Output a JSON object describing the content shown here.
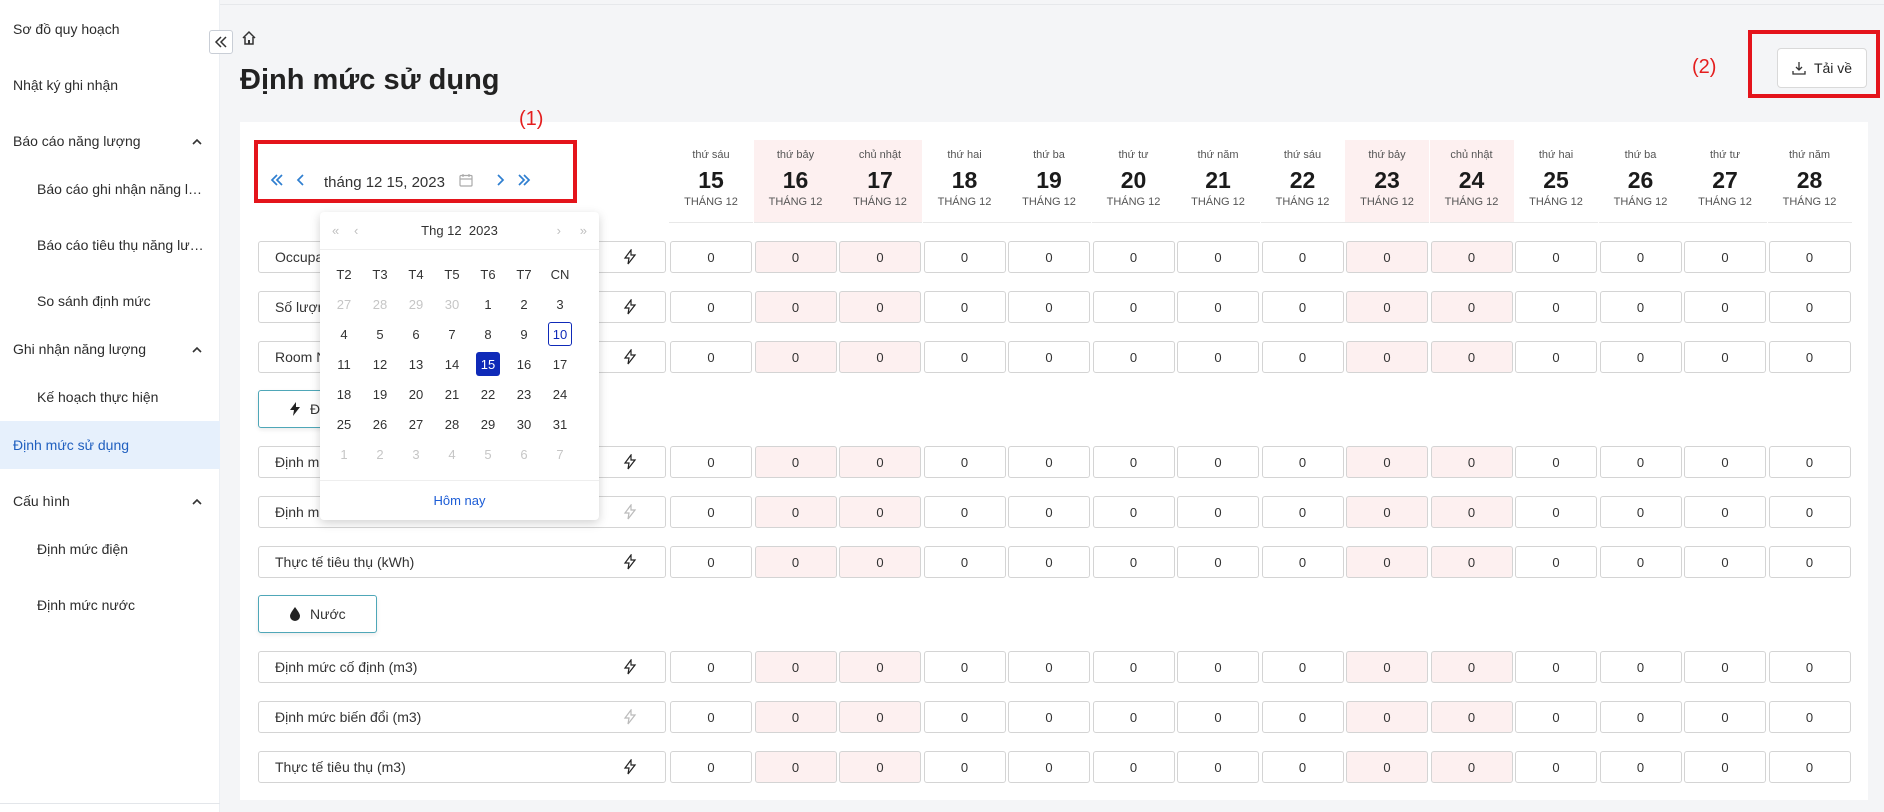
{
  "sidebar": {
    "items": [
      {
        "label": "Sơ đồ quy hoạch"
      },
      {
        "label": "Nhật ký ghi nhận"
      },
      {
        "label": "Báo cáo năng lượng"
      },
      {
        "label": "Báo cáo ghi nhận năng lượng"
      },
      {
        "label": "Báo cáo tiêu thụ năng lượng"
      },
      {
        "label": "So sánh định mức"
      },
      {
        "label": "Ghi nhận năng lượng"
      },
      {
        "label": "Kế hoạch thực hiện"
      },
      {
        "label": "Định mức sử dụng"
      },
      {
        "label": "Cấu hình"
      },
      {
        "label": "Định mức điện"
      },
      {
        "label": "Định mức nước"
      }
    ]
  },
  "header": {
    "title": "Định mức sử dụng",
    "download_label": "Tải về",
    "annotation_1": "(1)",
    "annotation_2": "(2)"
  },
  "date_picker": {
    "value": "tháng 12 15, 2023"
  },
  "days": [
    {
      "name": "thứ sáu",
      "num": "15",
      "month": "THÁNG 12"
    },
    {
      "name": "thứ bảy",
      "num": "16",
      "month": "THÁNG 12"
    },
    {
      "name": "chủ nhật",
      "num": "17",
      "month": "THÁNG 12"
    },
    {
      "name": "thứ hai",
      "num": "18",
      "month": "THÁNG 12"
    },
    {
      "name": "thứ ba",
      "num": "19",
      "month": "THÁNG 12"
    },
    {
      "name": "thứ tư",
      "num": "20",
      "month": "THÁNG 12"
    },
    {
      "name": "thứ năm",
      "num": "21",
      "month": "THÁNG 12"
    },
    {
      "name": "thứ sáu",
      "num": "22",
      "month": "THÁNG 12"
    },
    {
      "name": "thứ bảy",
      "num": "23",
      "month": "THÁNG 12"
    },
    {
      "name": "chủ nhật",
      "num": "24",
      "month": "THÁNG 12"
    },
    {
      "name": "thứ hai",
      "num": "25",
      "month": "THÁNG 12"
    },
    {
      "name": "thứ ba",
      "num": "26",
      "month": "THÁNG 12"
    },
    {
      "name": "thứ tư",
      "num": "27",
      "month": "THÁNG 12"
    },
    {
      "name": "thứ năm",
      "num": "28",
      "month": "THÁNG 12"
    }
  ],
  "rows": [
    {
      "label": "Occupa",
      "values": [
        "0",
        "0",
        "0",
        "0",
        "0",
        "0",
        "0",
        "0",
        "0",
        "0",
        "0",
        "0",
        "0",
        "0"
      ]
    },
    {
      "label": "Số lượn",
      "values": [
        "0",
        "0",
        "0",
        "0",
        "0",
        "0",
        "0",
        "0",
        "0",
        "0",
        "0",
        "0",
        "0",
        "0"
      ]
    },
    {
      "label": "Room N",
      "values": [
        "0",
        "0",
        "0",
        "0",
        "0",
        "0",
        "0",
        "0",
        "0",
        "0",
        "0",
        "0",
        "0",
        "0"
      ]
    },
    {
      "label": "Định m",
      "values": [
        "0",
        "0",
        "0",
        "0",
        "0",
        "0",
        "0",
        "0",
        "0",
        "0",
        "0",
        "0",
        "0",
        "0"
      ]
    },
    {
      "label": "Định m",
      "values": [
        "0",
        "0",
        "0",
        "0",
        "0",
        "0",
        "0",
        "0",
        "0",
        "0",
        "0",
        "0",
        "0",
        "0"
      ]
    },
    {
      "label": "Thực tế tiêu thụ (kWh)",
      "values": [
        "0",
        "0",
        "0",
        "0",
        "0",
        "0",
        "0",
        "0",
        "0",
        "0",
        "0",
        "0",
        "0",
        "0"
      ]
    },
    {
      "label": "Định mức cố định (m3)",
      "values": [
        "0",
        "0",
        "0",
        "0",
        "0",
        "0",
        "0",
        "0",
        "0",
        "0",
        "0",
        "0",
        "0",
        "0"
      ]
    },
    {
      "label": "Định mức biến đổi (m3)",
      "values": [
        "0",
        "0",
        "0",
        "0",
        "0",
        "0",
        "0",
        "0",
        "0",
        "0",
        "0",
        "0",
        "0",
        "0"
      ]
    },
    {
      "label": "Thực tế tiêu thụ (m3)",
      "values": [
        "0",
        "0",
        "0",
        "0",
        "0",
        "0",
        "0",
        "0",
        "0",
        "0",
        "0",
        "0",
        "0",
        "0"
      ]
    }
  ],
  "sections": {
    "electric_label": "Đ",
    "water_label": "Nước"
  },
  "calendar": {
    "month_label": "Thg 12",
    "year_label": "2023",
    "weekdays": [
      "T2",
      "T3",
      "T4",
      "T5",
      "T6",
      "T7",
      "CN"
    ],
    "weeks": [
      [
        "27",
        "28",
        "29",
        "30",
        "1",
        "2",
        "3"
      ],
      [
        "4",
        "5",
        "6",
        "7",
        "8",
        "9",
        "10"
      ],
      [
        "11",
        "12",
        "13",
        "14",
        "15",
        "16",
        "17"
      ],
      [
        "18",
        "19",
        "20",
        "21",
        "22",
        "23",
        "24"
      ],
      [
        "25",
        "26",
        "27",
        "28",
        "29",
        "30",
        "31"
      ],
      [
        "1",
        "2",
        "3",
        "4",
        "5",
        "6",
        "7"
      ]
    ],
    "today_label": "Hôm nay",
    "today": "10",
    "selected": "15"
  },
  "colors": {
    "accent": "#2f7fd0",
    "selected_day": "#0f2ab8",
    "weekend_bg": "#fdf0f0",
    "annotation": "#e41e1e"
  }
}
